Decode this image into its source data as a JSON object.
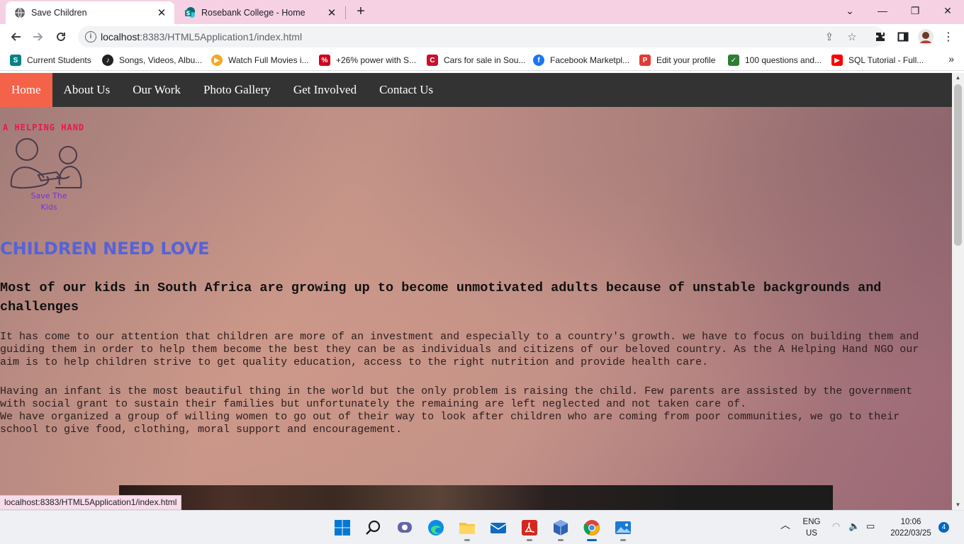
{
  "browser": {
    "tabs": [
      {
        "title": "Save Children",
        "active": true,
        "icon": "globe-icon"
      },
      {
        "title": "Rosebank College - Home",
        "active": false,
        "icon": "sharepoint-icon"
      }
    ],
    "url_host": "localhost",
    "url_rest": ":8383/HTML5Application1/index.html",
    "bookmarks": [
      {
        "label": "Current Students",
        "icon": "sharepoint-icon",
        "color": "#038387"
      },
      {
        "label": "Songs, Videos, Albu...",
        "icon": "music-icon",
        "color": "#222222"
      },
      {
        "label": "Watch Full Movies i...",
        "icon": "play-icon",
        "color": "#f5a623"
      },
      {
        "label": "+26% power with S...",
        "icon": "promo-icon",
        "color": "#d0021b"
      },
      {
        "label": "Cars for sale in Sou...",
        "icon": "car-icon",
        "color": "#c8102e"
      },
      {
        "label": "Facebook Marketpl...",
        "icon": "facebook-icon",
        "color": "#1877f2"
      },
      {
        "label": "Edit your profile",
        "icon": "profile-icon",
        "color": "#e53935"
      },
      {
        "label": "100 questions and...",
        "icon": "quiz-icon",
        "color": "#2e7d32"
      },
      {
        "label": "SQL Tutorial - Full...",
        "icon": "youtube-icon",
        "color": "#ff0000"
      }
    ],
    "status_url": "localhost:8383/HTML5Application1/index.html"
  },
  "site": {
    "nav": [
      "Home",
      "About Us",
      "Our Work",
      "Photo Gallery",
      "Get Involved",
      "Contact Us"
    ],
    "active_nav": "Home",
    "logo_title": "A HELPING HAND",
    "logo_caption": "Save The Kids",
    "heading": "CHILDREN NEED LOVE",
    "subheading": "Most of our kids in South Africa are growing up to become unmotivated adults because of unstable backgrounds and challenges",
    "paragraph1": "It has come to our attention that children are more of an investment and especially to a country's growth. we have to focus on building them and guiding them in order to help them become the best they can be as individuals and citizens of our beloved country. As the A Helping Hand NGO our aim is to help children strive to get quality education, access to the right nutrition and provide health care.",
    "paragraph2": "Having an infant is the most beautiful thing in the world but the only problem is raising the child. Few parents are assisted by the government with social grant to sustain their families but unfortunately the remaining are left neglected and not taken care of.",
    "paragraph3": "We have organized a group of willing women to go out of their way to look after children who are coming from poor communities, we go to their school to give food, clothing, moral support and encouragement.",
    "colors": {
      "nav_bg": "#333333",
      "nav_active": "#f4624a",
      "heading": "#5662d8",
      "logo_title": "#e8174f",
      "logo_caption": "#7c2ee0"
    }
  },
  "taskbar": {
    "lang": "ENG",
    "region": "US",
    "time": "10:06",
    "date": "2022/03/25",
    "notifications": "4",
    "apps": [
      "start-icon",
      "search-icon",
      "chat-icon",
      "edge-icon",
      "file-explorer-icon",
      "mail-icon",
      "acrobat-icon",
      "virtualbox-icon",
      "chrome-icon",
      "photos-icon"
    ]
  }
}
